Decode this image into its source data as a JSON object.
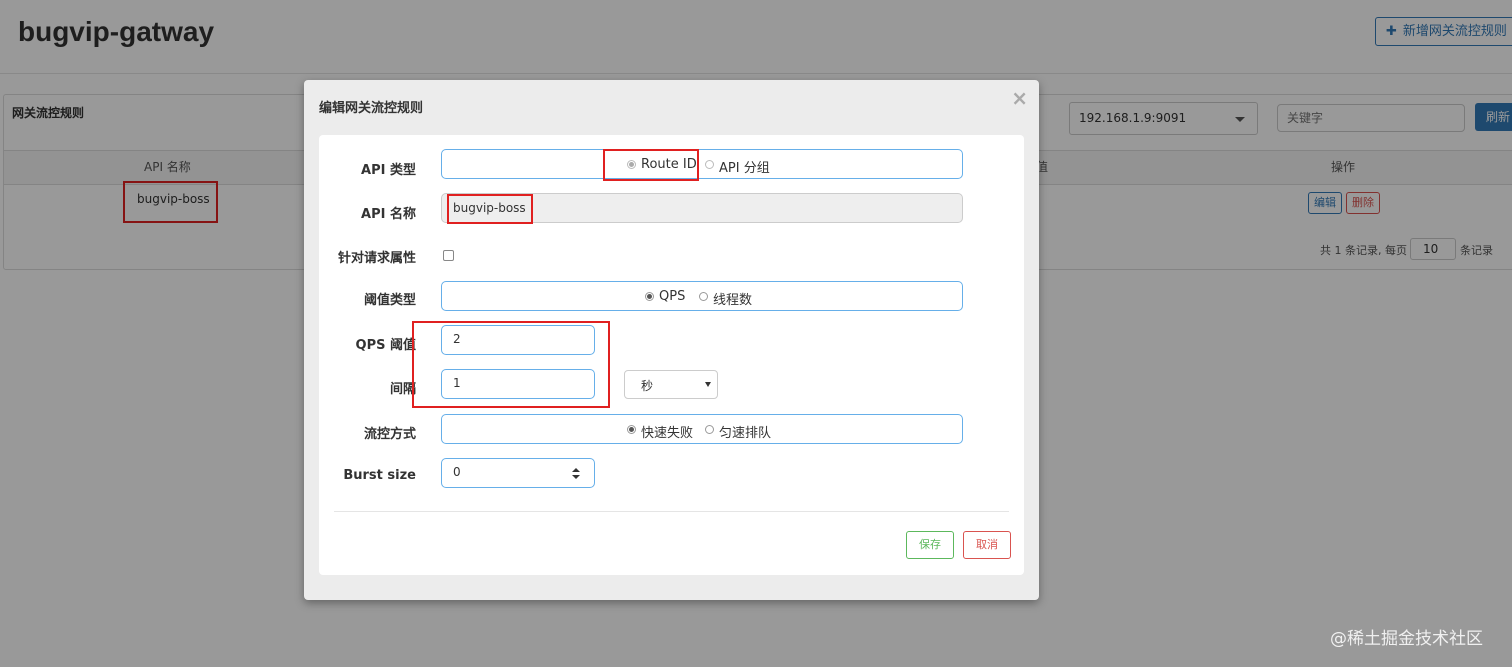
{
  "app": {
    "title": "bugvip-gatway",
    "add_rule_button": "新增网关流控规则"
  },
  "panel": {
    "title": "网关流控规则",
    "machine_select": "192.168.1.9:9091",
    "keyword_placeholder": "关键字",
    "refresh_button": "刷新",
    "columns": {
      "api_name": "API 名称",
      "threshold_partial": "值",
      "operation": "操作"
    },
    "rows": [
      {
        "api_name": "bugvip-boss",
        "edit": "编辑",
        "delete": "删除"
      }
    ],
    "pager": {
      "prefix": "共 1 条记录, 每页",
      "page_size": "10",
      "suffix": "条记录"
    }
  },
  "modal": {
    "title": "编辑网关流控规则",
    "close": "×",
    "fields": {
      "api_type": {
        "label": "API 类型",
        "options": [
          "Route ID",
          "API 分组"
        ],
        "selected": "Route ID"
      },
      "api_name": {
        "label": "API 名称",
        "value": "bugvip-boss"
      },
      "param_item": {
        "label": "针对请求属性",
        "checked": false
      },
      "grade": {
        "label": "阈值类型",
        "options": [
          "QPS",
          "线程数"
        ],
        "selected": "QPS"
      },
      "count": {
        "label": "QPS 阈值",
        "value": "2"
      },
      "interval": {
        "label": "间隔",
        "value": "1",
        "unit": "秒"
      },
      "control_behavior": {
        "label": "流控方式",
        "options": [
          "快速失败",
          "匀速排队"
        ],
        "selected": "快速失败"
      },
      "burst": {
        "label": "Burst size",
        "value": "0"
      }
    },
    "buttons": {
      "save": "保存",
      "cancel": "取消"
    }
  },
  "watermark": "@稀土掘金技术社区",
  "colors": {
    "primary": "#337ab7",
    "danger": "#d9534f",
    "success": "#5cb85c",
    "highlight": "#e02020",
    "focus_border": "#66afe9"
  }
}
